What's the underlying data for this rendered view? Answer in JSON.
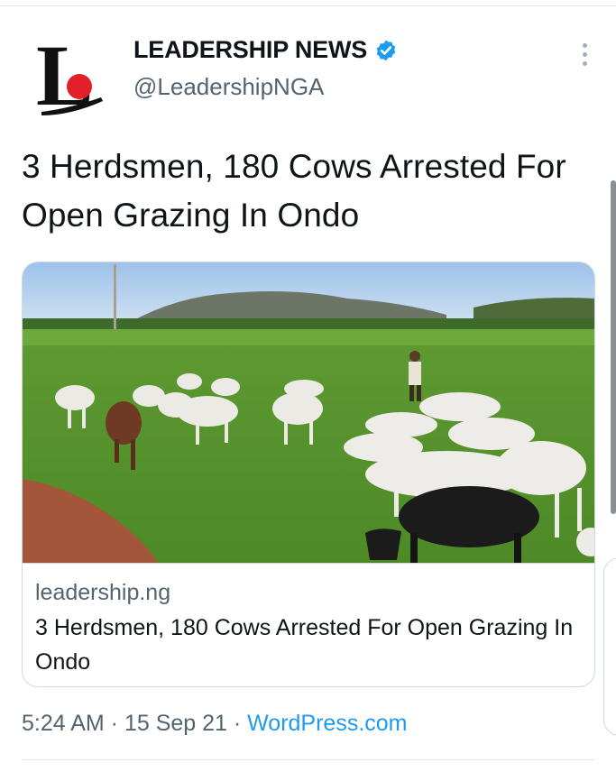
{
  "tweet": {
    "author_name": "LEADERSHIP NEWS",
    "handle": "@LeadershipNGA",
    "avatar_letter": "L",
    "text": "3 Herdsmen, 180 Cows Arrested For Open Grazing In Ondo",
    "timestamp": "5:24 AM · 15 Sep 21 · ",
    "source": "WordPress.com"
  },
  "card": {
    "domain": "leadership.ng",
    "title": "3 Herdsmen, 180 Cows Arrested For Open Grazing In Ondo",
    "image_alt": "cattle-grazing-photo"
  },
  "icons": {
    "verified": "verified-badge-icon",
    "more": "more-options-icon"
  },
  "colors": {
    "brand_red": "#e3202a",
    "verified_blue": "#1d9bf0",
    "link_blue": "#1d9bf0",
    "muted": "#536471"
  }
}
